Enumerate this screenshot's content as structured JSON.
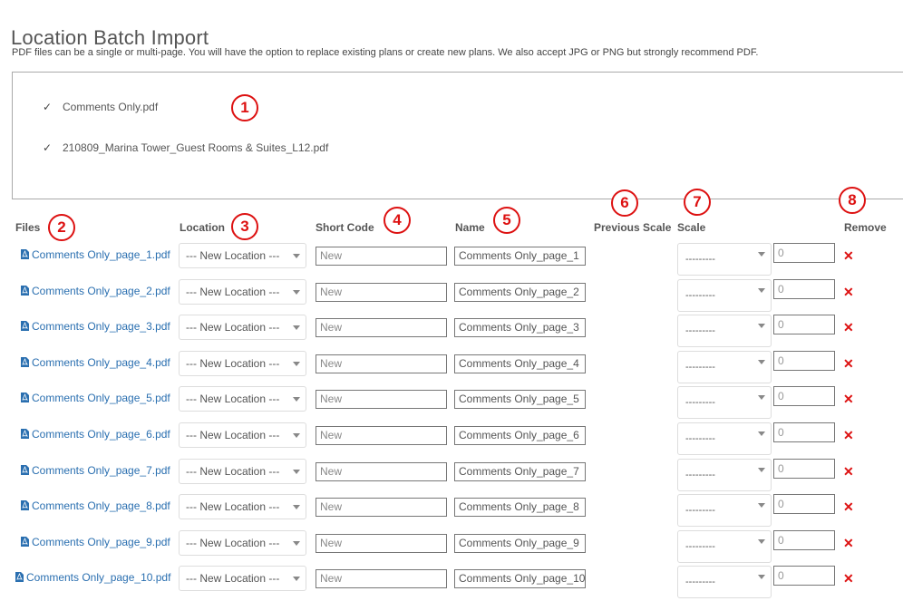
{
  "page": {
    "title": "Location Batch Import",
    "description": "PDF files can be a single or multi-page. You will have the option to replace existing plans or create new plans. We also accept JPG or PNG but strongly recommend PDF."
  },
  "uploaded_files": [
    {
      "check": "✓",
      "name": "Comments Only.pdf"
    },
    {
      "check": "✓",
      "name": "210809_Marina Tower_Guest Rooms & Suites_L12.pdf"
    }
  ],
  "columns": {
    "files": "Files",
    "location": "Location",
    "short_code": "Short Code",
    "name": "Name",
    "previous_scale": "Previous Scale",
    "scale": "Scale",
    "remove": "Remove"
  },
  "callouts": [
    "1",
    "2",
    "3",
    "4",
    "5",
    "6",
    "7",
    "8"
  ],
  "rows": [
    {
      "file": "Comments Only_page_1.pdf",
      "location": "--- New Location ---",
      "short_code": "New",
      "name": "Comments Only_page_1",
      "scale": "---------",
      "scale_value": "0",
      "remove": "✕"
    },
    {
      "file": "Comments Only_page_2.pdf",
      "location": "--- New Location ---",
      "short_code": "New",
      "name": "Comments Only_page_2",
      "scale": "---------",
      "scale_value": "0",
      "remove": "✕"
    },
    {
      "file": "Comments Only_page_3.pdf",
      "location": "--- New Location ---",
      "short_code": "New",
      "name": "Comments Only_page_3",
      "scale": "---------",
      "scale_value": "0",
      "remove": "✕"
    },
    {
      "file": "Comments Only_page_4.pdf",
      "location": "--- New Location ---",
      "short_code": "New",
      "name": "Comments Only_page_4",
      "scale": "---------",
      "scale_value": "0",
      "remove": "✕"
    },
    {
      "file": "Comments Only_page_5.pdf",
      "location": "--- New Location ---",
      "short_code": "New",
      "name": "Comments Only_page_5",
      "scale": "---------",
      "scale_value": "0",
      "remove": "✕"
    },
    {
      "file": "Comments Only_page_6.pdf",
      "location": "--- New Location ---",
      "short_code": "New",
      "name": "Comments Only_page_6",
      "scale": "---------",
      "scale_value": "0",
      "remove": "✕"
    },
    {
      "file": "Comments Only_page_7.pdf",
      "location": "--- New Location ---",
      "short_code": "New",
      "name": "Comments Only_page_7",
      "scale": "---------",
      "scale_value": "0",
      "remove": "✕"
    },
    {
      "file": "Comments Only_page_8.pdf",
      "location": "--- New Location ---",
      "short_code": "New",
      "name": "Comments Only_page_8",
      "scale": "---------",
      "scale_value": "0",
      "remove": "✕"
    },
    {
      "file": "Comments Only_page_9.pdf",
      "location": "--- New Location ---",
      "short_code": "New",
      "name": "Comments Only_page_9",
      "scale": "---------",
      "scale_value": "0",
      "remove": "✕"
    },
    {
      "file": "Comments Only_page_10.pdf",
      "location": "--- New Location ---",
      "short_code": "New",
      "name": "Comments Only_page_10",
      "scale": "---------",
      "scale_value": "0",
      "remove": "✕"
    }
  ],
  "colors": {
    "link": "#2a6fb0",
    "callout": "#dd1111",
    "remove": "#dd1111"
  },
  "icons": {
    "file": "pdf-file-icon",
    "dropdown": "chevron-down-icon",
    "remove": "close-icon",
    "check": "checkmark-icon"
  }
}
